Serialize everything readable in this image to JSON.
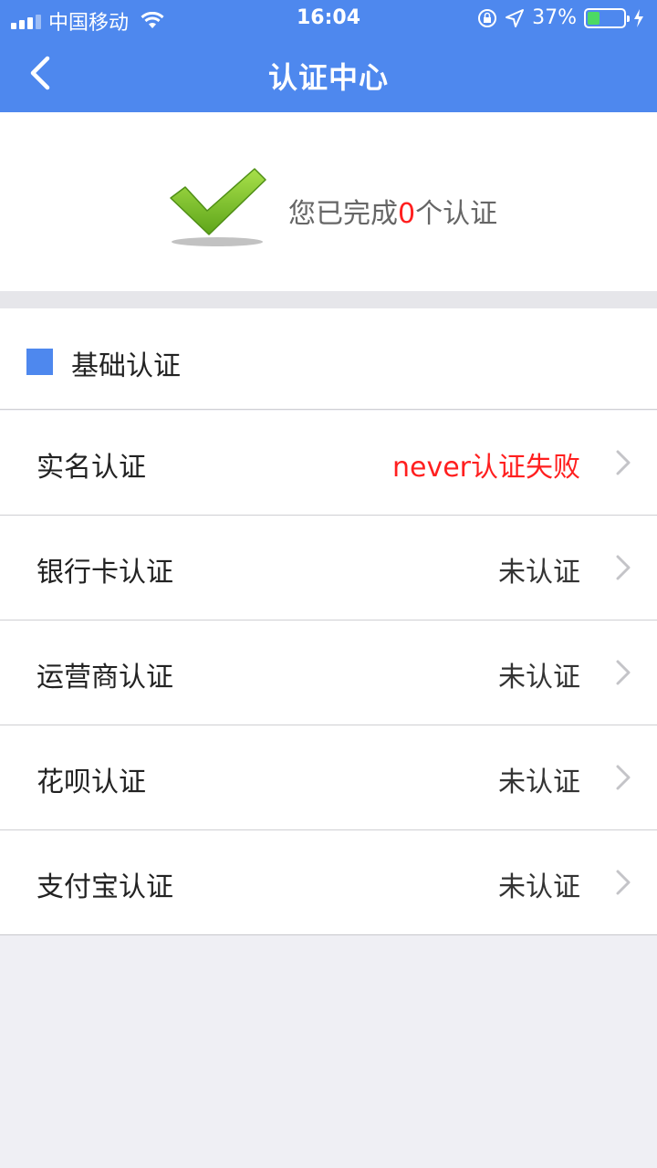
{
  "status_bar": {
    "carrier": "中国移动",
    "time": "16:04",
    "battery": "37%",
    "battery_level": 0.37
  },
  "nav": {
    "title": "认证中心"
  },
  "summary": {
    "prefix": "您已完成",
    "count": "0",
    "suffix": "个认证"
  },
  "section": {
    "title": "基础认证"
  },
  "items": [
    {
      "label": "实名认证",
      "status": "never认证失败",
      "failed": true
    },
    {
      "label": "银行卡认证",
      "status": "未认证",
      "failed": false
    },
    {
      "label": "运营商认证",
      "status": "未认证",
      "failed": false
    },
    {
      "label": "花呗认证",
      "status": "未认证",
      "failed": false
    },
    {
      "label": "支付宝认证",
      "status": "未认证",
      "failed": false
    }
  ],
  "colors": {
    "accent": "#4e88ee",
    "fail": "#ff1f1f",
    "check": "#7cc624"
  }
}
